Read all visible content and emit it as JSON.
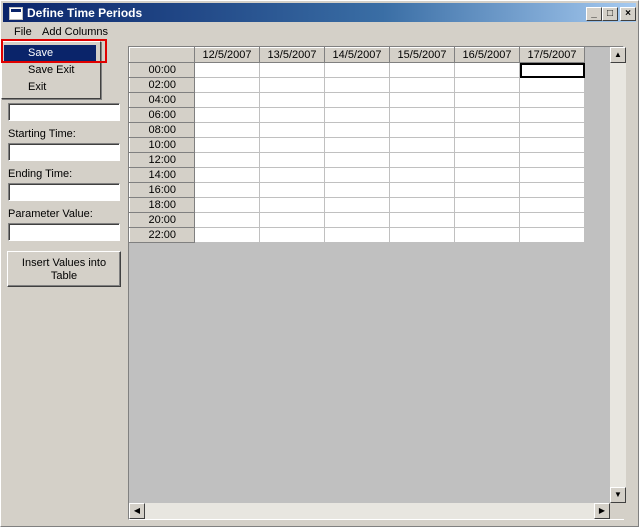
{
  "window": {
    "title": "Define Time Periods"
  },
  "controls": {
    "minimize": "_",
    "maximize": "□",
    "close": "×"
  },
  "menu": {
    "file": "File",
    "add_columns": "Add Columns"
  },
  "file_menu": {
    "save": "Save",
    "save_exit": "Save  Exit",
    "exit": "Exit"
  },
  "form": {
    "field1_value": "",
    "starting_time_label": "Starting Time:",
    "starting_time_value": "",
    "ending_time_label": "Ending Time:",
    "ending_time_value": "",
    "parameter_value_label": "Parameter Value:",
    "parameter_value_value": "",
    "insert_button": "Insert Values into Table"
  },
  "grid": {
    "columns": [
      "12/5/2007",
      "13/5/2007",
      "14/5/2007",
      "15/5/2007",
      "16/5/2007",
      "17/5/2007"
    ],
    "rows": [
      "00:00",
      "02:00",
      "04:00",
      "06:00",
      "08:00",
      "10:00",
      "12:00",
      "14:00",
      "16:00",
      "18:00",
      "20:00",
      "22:00"
    ],
    "selected_row": 0,
    "selected_col": 5
  },
  "colors": {
    "title_start": "#0a246a",
    "title_end": "#a6caf0",
    "highlight_border": "#e00000",
    "face": "#d4d0c8"
  },
  "icons": {
    "app": "app-window-icon",
    "scroll_up": "arrow-up-icon",
    "scroll_down": "arrow-down-icon",
    "scroll_left": "arrow-left-icon",
    "scroll_right": "arrow-right-icon"
  }
}
